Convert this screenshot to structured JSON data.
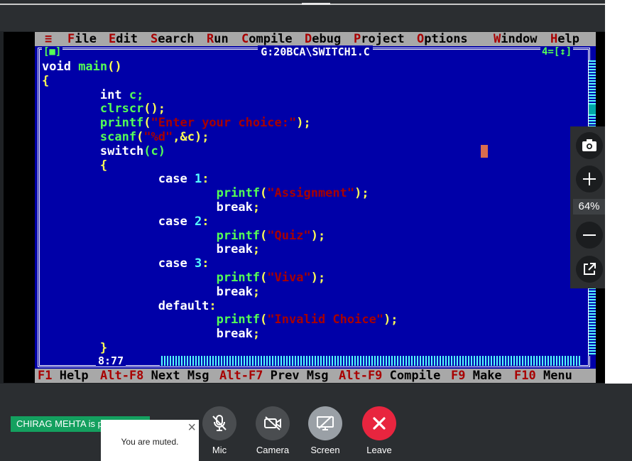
{
  "editor": {
    "menu": [
      {
        "hot": "≡",
        "rest": ""
      },
      {
        "hot": "F",
        "rest": "ile"
      },
      {
        "hot": "E",
        "rest": "dit"
      },
      {
        "hot": "S",
        "rest": "earch"
      },
      {
        "hot": "R",
        "rest": "un"
      },
      {
        "hot": "C",
        "rest": "ompile"
      },
      {
        "hot": "D",
        "rest": "ebug"
      },
      {
        "hot": "P",
        "rest": "roject"
      },
      {
        "hot": "O",
        "rest": "ptions"
      },
      {
        "hot": "W",
        "rest": "indow"
      },
      {
        "hot": "H",
        "rest": "elp"
      }
    ],
    "window_title": "G:20BCA\\SWITCH1.C",
    "close_box": "[■]",
    "window_number": "4=[↕]",
    "cursor_position": "8:77",
    "code_lines": [
      [
        {
          "t": "void ",
          "c": "kw"
        },
        {
          "t": "main",
          "c": "fn"
        },
        {
          "t": "()",
          "c": "pn"
        }
      ],
      [
        {
          "t": "{",
          "c": "pn"
        }
      ],
      [
        {
          "t": "        int ",
          "c": "kw"
        },
        {
          "t": "c;",
          "c": "fn"
        }
      ],
      [
        {
          "t": "        clrscr",
          "c": "fn"
        },
        {
          "t": "();",
          "c": "pn"
        }
      ],
      [
        {
          "t": "        printf",
          "c": "fn"
        },
        {
          "t": "(",
          "c": "pn"
        },
        {
          "t": "\"Enter your choice:\"",
          "c": "str"
        },
        {
          "t": ");",
          "c": "pn"
        }
      ],
      [
        {
          "t": "        scanf",
          "c": "fn"
        },
        {
          "t": "(",
          "c": "pn"
        },
        {
          "t": "\"%d\"",
          "c": "str"
        },
        {
          "t": ",&c);",
          "c": "pn"
        }
      ],
      [
        {
          "t": "        switch",
          "c": "kw"
        },
        {
          "t": "(c)",
          "c": "fn"
        }
      ],
      [
        {
          "t": "        {",
          "c": "pn"
        }
      ],
      [
        {
          "t": "                case ",
          "c": "kw"
        },
        {
          "t": "1",
          "c": "num"
        },
        {
          "t": ":",
          "c": "pn"
        }
      ],
      [
        {
          "t": "                        printf",
          "c": "fn"
        },
        {
          "t": "(",
          "c": "pn"
        },
        {
          "t": "\"Assignment\"",
          "c": "str"
        },
        {
          "t": ");",
          "c": "pn"
        }
      ],
      [
        {
          "t": "                        break",
          "c": "kw"
        },
        {
          "t": ";",
          "c": "pn"
        }
      ],
      [
        {
          "t": "                case ",
          "c": "kw"
        },
        {
          "t": "2",
          "c": "num"
        },
        {
          "t": ":",
          "c": "pn"
        }
      ],
      [
        {
          "t": "                        printf",
          "c": "fn"
        },
        {
          "t": "(",
          "c": "pn"
        },
        {
          "t": "\"Quiz\"",
          "c": "str"
        },
        {
          "t": ");",
          "c": "pn"
        }
      ],
      [
        {
          "t": "                        break",
          "c": "kw"
        },
        {
          "t": ";",
          "c": "pn"
        }
      ],
      [
        {
          "t": "                case ",
          "c": "kw"
        },
        {
          "t": "3",
          "c": "num"
        },
        {
          "t": ":",
          "c": "pn"
        }
      ],
      [
        {
          "t": "                        printf",
          "c": "fn"
        },
        {
          "t": "(",
          "c": "pn"
        },
        {
          "t": "\"Viva\"",
          "c": "str"
        },
        {
          "t": ");",
          "c": "pn"
        }
      ],
      [
        {
          "t": "                        break",
          "c": "kw"
        },
        {
          "t": ";",
          "c": "pn"
        }
      ],
      [
        {
          "t": "                default",
          "c": "kw"
        },
        {
          "t": ":",
          "c": "pn"
        }
      ],
      [
        {
          "t": "                        printf",
          "c": "fn"
        },
        {
          "t": "(",
          "c": "pn"
        },
        {
          "t": "\"Invalid Choice\"",
          "c": "str"
        },
        {
          "t": ");",
          "c": "pn"
        }
      ],
      [
        {
          "t": "                        break",
          "c": "kw"
        },
        {
          "t": ";",
          "c": "pn"
        }
      ],
      [
        {
          "t": "        }",
          "c": "pn"
        }
      ]
    ],
    "status": [
      {
        "hot": "F1",
        "rest": " Help"
      },
      {
        "hot": "Alt-F8",
        "rest": " Next Msg"
      },
      {
        "hot": "Alt-F7",
        "rest": " Prev Msg"
      },
      {
        "hot": "Alt-F9",
        "rest": " Compile"
      },
      {
        "hot": "F9",
        "rest": " Make"
      },
      {
        "hot": "F10",
        "rest": " Menu"
      }
    ]
  },
  "zoom": {
    "value": "64%",
    "icons": [
      "camera-snapshot-icon",
      "zoom-in-icon",
      "zoom-out-icon",
      "popout-icon"
    ]
  },
  "meeting": {
    "presenting_label": "CHIRAG MEHTA is presenting",
    "toast_message": "You are muted.",
    "toast_close": "×",
    "controls": [
      {
        "label": "Mic",
        "icon": "mic-off-icon",
        "color": "#4a4d50"
      },
      {
        "label": "Camera",
        "icon": "camera-off-icon",
        "color": "#4a4d50"
      },
      {
        "label": "Screen",
        "icon": "screen-share-icon",
        "color": "#9aa0a6"
      },
      {
        "label": "Leave",
        "icon": "close-icon",
        "color": "#e8253f"
      }
    ]
  }
}
